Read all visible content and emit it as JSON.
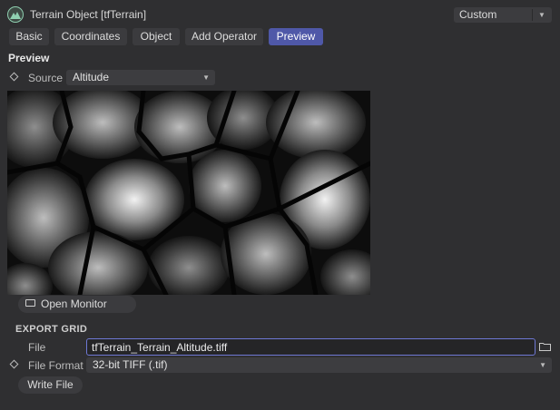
{
  "header": {
    "title": "Terrain Object [tfTerrain]",
    "preset": "Custom"
  },
  "tabs": [
    {
      "label": "Basic",
      "active": false
    },
    {
      "label": "Coordinates",
      "active": false
    },
    {
      "label": "Object",
      "active": false
    },
    {
      "label": "Add Operator",
      "active": false
    },
    {
      "label": "Preview",
      "active": true
    }
  ],
  "preview": {
    "section_title": "Preview",
    "source_label": "Source",
    "source_value": "Altitude",
    "open_monitor_label": "Open Monitor"
  },
  "export": {
    "section_title": "EXPORT GRID",
    "file_label": "File",
    "file_value": "tfTerrain_Terrain_Altitude.tiff",
    "format_label": "File Format",
    "format_value": "32-bit TIFF (.tif)",
    "write_button": "Write File"
  },
  "colors": {
    "background": "#2f2f31",
    "accent": "#4f58a8",
    "input_focus": "#6e78d4",
    "logo": "#8fcfb0"
  },
  "icons": [
    "terrain-logo-icon",
    "chevron-down-icon",
    "keyframe-diamond-icon",
    "monitor-icon",
    "folder-icon"
  ]
}
